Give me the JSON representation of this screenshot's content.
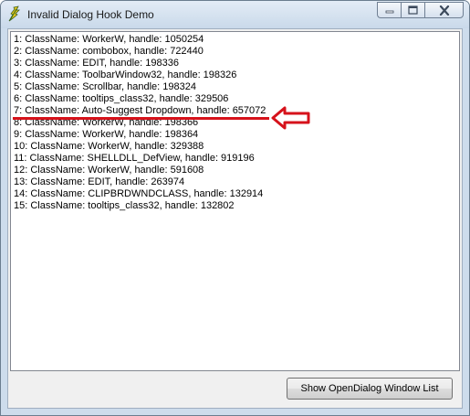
{
  "window": {
    "title": "Invalid Dialog Hook Demo",
    "app_icon": "feather-app-icon",
    "controls": [
      "minimize-icon",
      "maximize-icon",
      "close-icon"
    ]
  },
  "list": {
    "items": [
      "1: ClassName: WorkerW, handle: 1050254",
      "2: ClassName: combobox, handle: 722440",
      "3: ClassName: EDIT, handle: 198336",
      "4: ClassName: ToolbarWindow32, handle: 198326",
      "5: ClassName: Scrollbar, handle: 198324",
      "6: ClassName: tooltips_class32, handle: 329506",
      "7: ClassName: Auto-Suggest Dropdown, handle: 657072",
      "8: ClassName: WorkerW, handle: 198366",
      "9: ClassName: WorkerW, handle: 198364",
      "10: ClassName: WorkerW, handle: 329388",
      "11: ClassName: SHELLDLL_DefView, handle: 919196",
      "12: ClassName: WorkerW, handle: 591608",
      "13: ClassName: EDIT, handle: 263974",
      "14: ClassName: CLIPBRDWNDCLASS, handle: 132914",
      "15: ClassName: tooltips_class32, handle: 132802"
    ],
    "highlighted_item_index": 6
  },
  "annotation": {
    "color": "#d6121b",
    "icon": "red-arrow-icon"
  },
  "button": {
    "label": "Show OpenDialog Window List"
  }
}
